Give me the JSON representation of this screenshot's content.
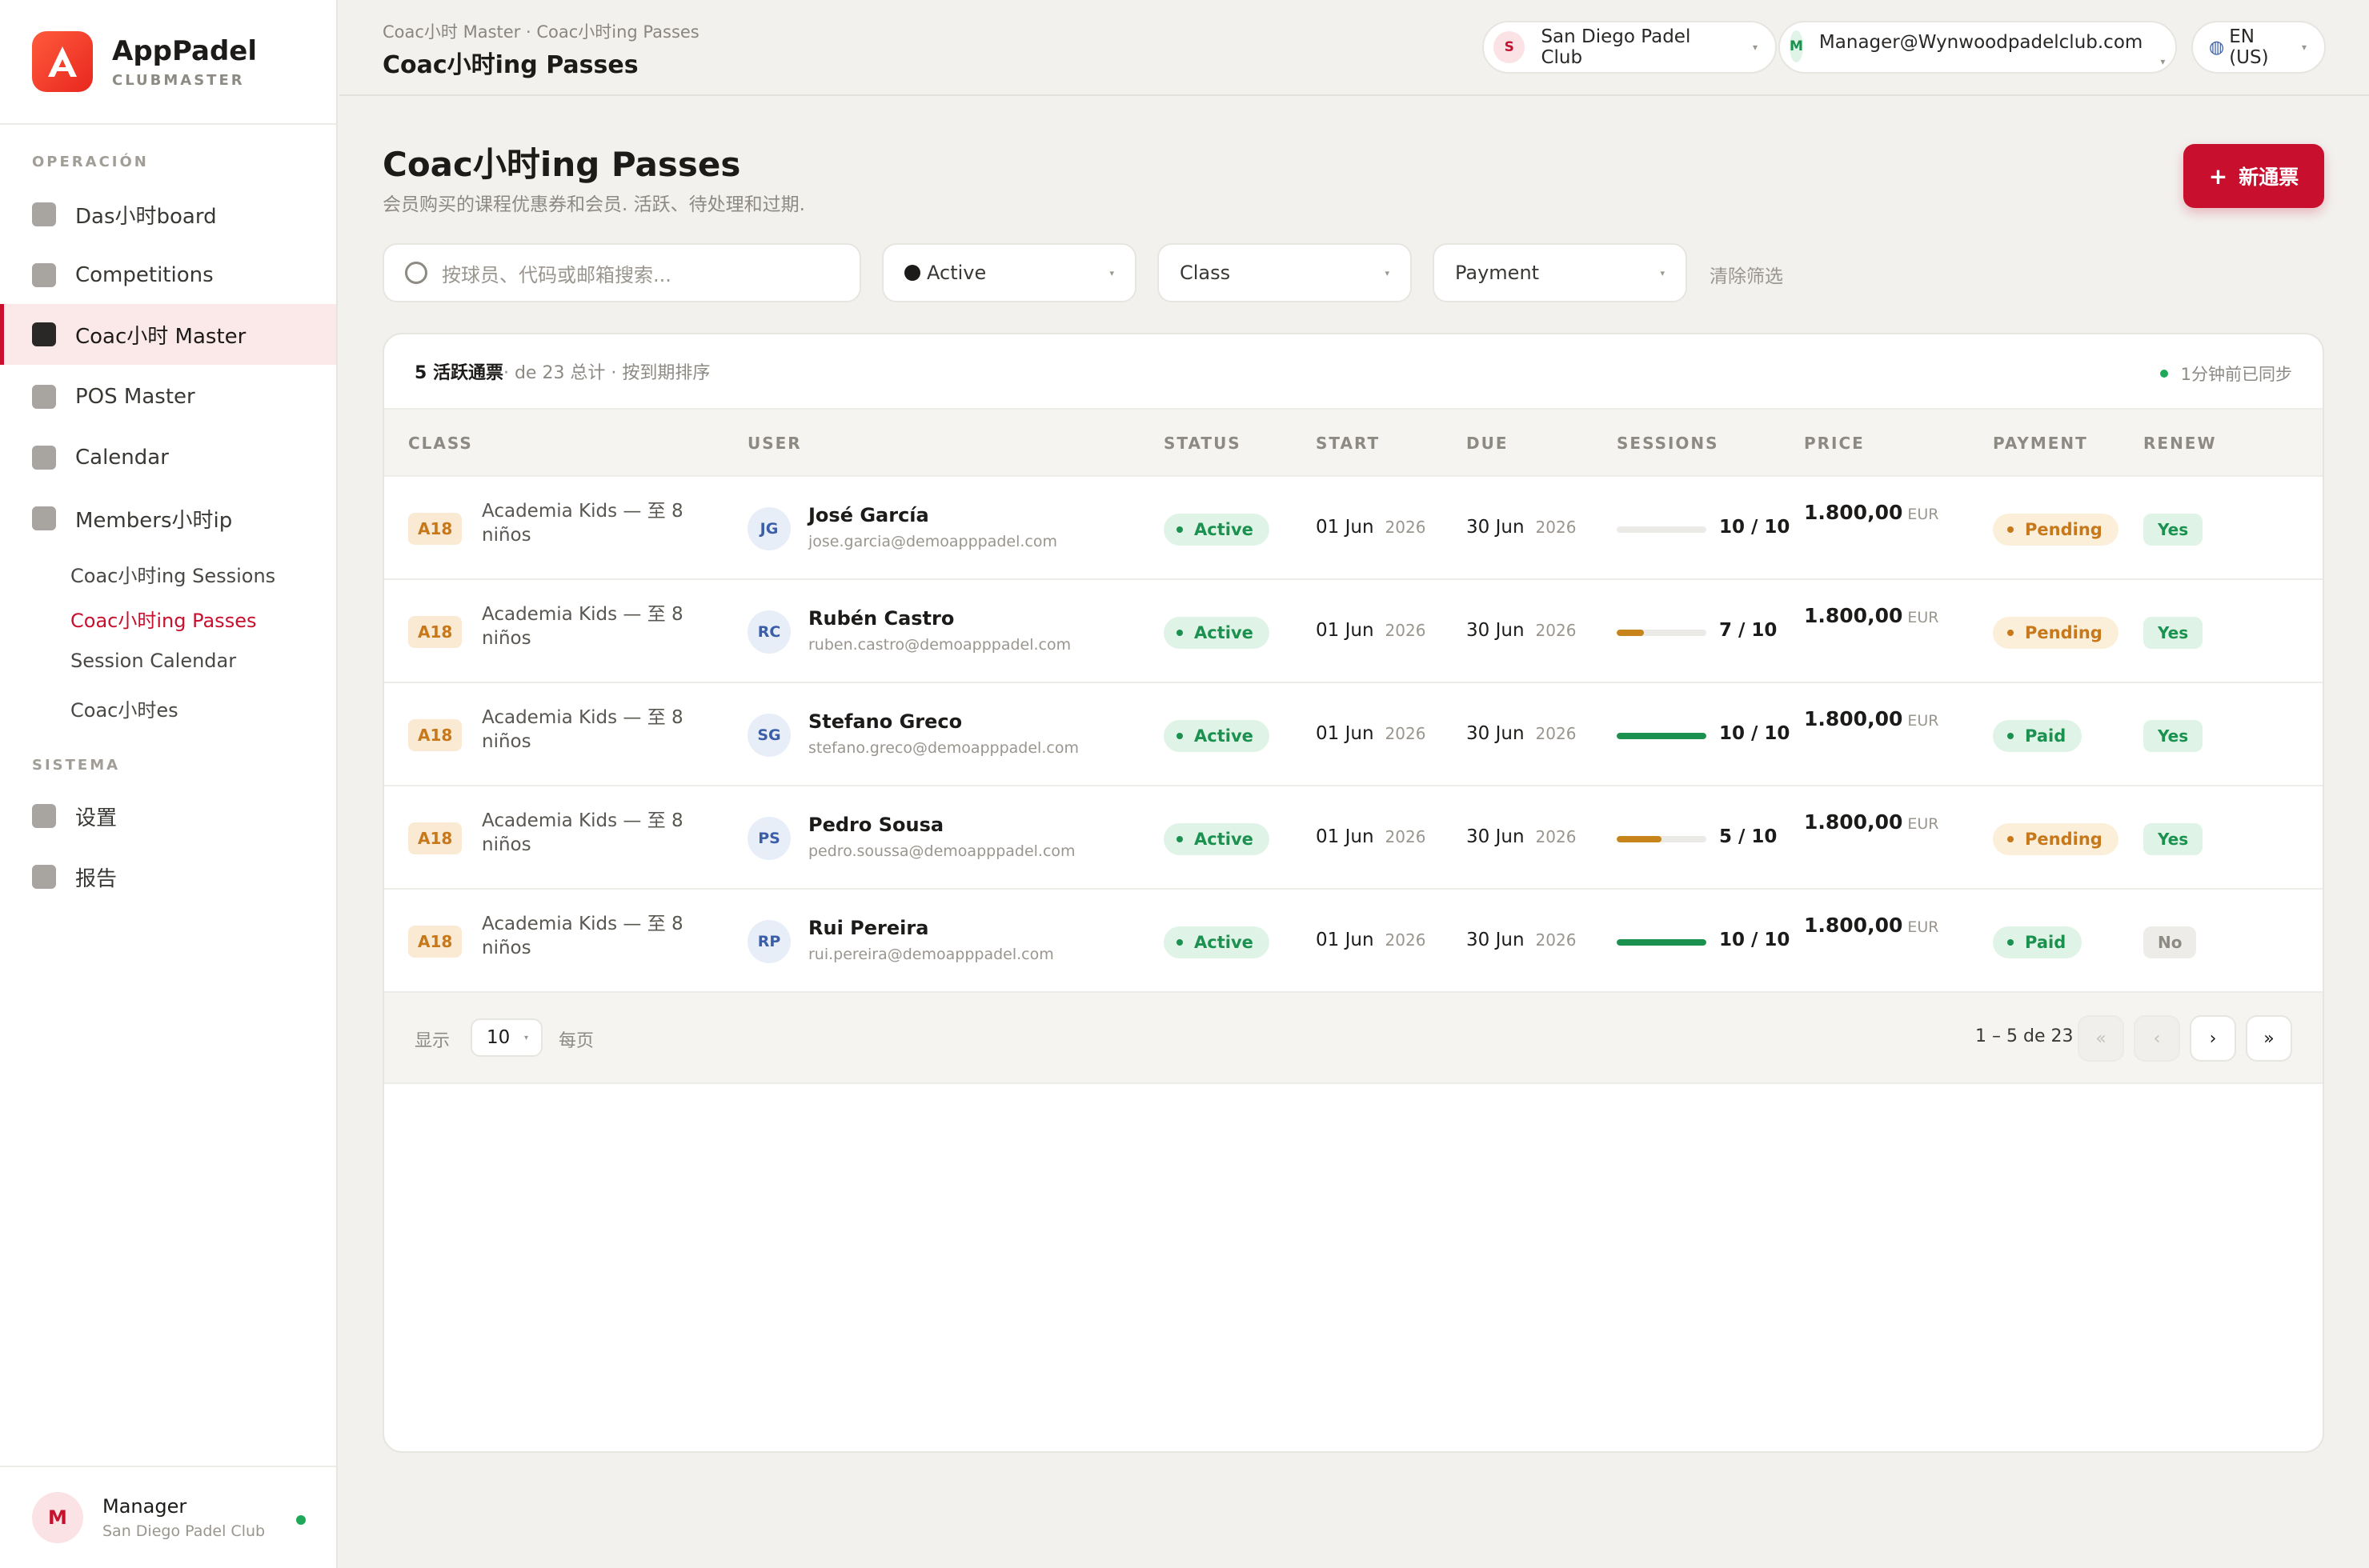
{
  "app": {
    "name": "AppPadel",
    "subtitle": "CLUBMASTER"
  },
  "sidebar": {
    "section_ops": "OPERACIÓN",
    "section_sys": "SISTEMA",
    "items": [
      {
        "label": "Das小时board"
      },
      {
        "label": "Competitions"
      },
      {
        "label": "Coac小时 Master"
      },
      {
        "label": "POS Master"
      },
      {
        "label": "Calendar"
      },
      {
        "label": "Members小时ip"
      }
    ],
    "sub_items": [
      {
        "label": "Coac小时ing Sessions"
      },
      {
        "label": "Coac小时ing Passes"
      },
      {
        "label": "Session Calendar"
      },
      {
        "label": "Coac小时es"
      }
    ],
    "system_items": [
      {
        "label": "设置"
      },
      {
        "label": "报告"
      }
    ],
    "user": {
      "initial": "M",
      "name": "Manager",
      "club": "San Diego Padel Club"
    }
  },
  "topbar": {
    "breadcrumb": "Coac小时 Master · Coac小时ing Passes",
    "title": "Coac小时ing Passes",
    "club": {
      "initial": "S",
      "label": "San Diego Padel Club"
    },
    "account": {
      "initial": "M",
      "label": "Manager@Wynwoodpadelclub.com"
    },
    "language": "EN (US)"
  },
  "page": {
    "title": "Coac小时ing Passes",
    "subtitle": "会员购买的课程优惠券和会员. 活跃、待处理和过期.",
    "new_button": "新通票"
  },
  "filters": {
    "search_placeholder": "按球员、代码或邮箱搜索...",
    "status": "Active",
    "class": "Class",
    "payment": "Payment",
    "clear": "清除筛选"
  },
  "table": {
    "summary_count": "5 活跃通票",
    "summary_rest": " · de 23 总计 · 按到期排序",
    "sync": "1分钟前已同步",
    "columns": [
      "CLASS",
      "USER",
      "STATUS",
      "START",
      "DUE",
      "SESSIONS",
      "PRICE",
      "PAYMENT",
      "RENEW"
    ],
    "rows": [
      {
        "class_code": "A18",
        "class_name": "Academia Kids — 至 8 niños",
        "initials": "JG",
        "name": "José García",
        "email": "jose.garcia@demoapppadel.com",
        "status": "Active",
        "start": "01 Jun",
        "start_year": "2026",
        "due": "30 Jun",
        "due_year": "2026",
        "sessions": "10 / 10",
        "progress": 0.0,
        "price": "1.800,00",
        "currency": "EUR",
        "payment": "Pending",
        "renew": "Yes"
      },
      {
        "class_code": "A18",
        "class_name": "Academia Kids — 至 8 niños",
        "initials": "RC",
        "name": "Rubén Castro",
        "email": "ruben.castro@demoapppadel.com",
        "status": "Active",
        "start": "01 Jun",
        "start_year": "2026",
        "due": "30 Jun",
        "due_year": "2026",
        "sessions": "7 / 10",
        "progress": 0.3,
        "price": "1.800,00",
        "currency": "EUR",
        "payment": "Pending",
        "renew": "Yes"
      },
      {
        "class_code": "A18",
        "class_name": "Academia Kids — 至 8 niños",
        "initials": "SG",
        "name": "Stefano Greco",
        "email": "stefano.greco@demoapppadel.com",
        "status": "Active",
        "start": "01 Jun",
        "start_year": "2026",
        "due": "30 Jun",
        "due_year": "2026",
        "sessions": "10 / 10",
        "progress": 1.0,
        "price": "1.800,00",
        "currency": "EUR",
        "payment": "Paid",
        "renew": "Yes"
      },
      {
        "class_code": "A18",
        "class_name": "Academia Kids — 至 8 niños",
        "initials": "PS",
        "name": "Pedro Sousa",
        "email": "pedro.soussa@demoapppadel.com",
        "status": "Active",
        "start": "01 Jun",
        "start_year": "2026",
        "due": "30 Jun",
        "due_year": "2026",
        "sessions": "5 / 10",
        "progress": 0.5,
        "price": "1.800,00",
        "currency": "EUR",
        "payment": "Pending",
        "renew": "Yes"
      },
      {
        "class_code": "A18",
        "class_name": "Academia Kids — 至 8 niños",
        "initials": "RP",
        "name": "Rui Pereira",
        "email": "rui.pereira@demoapppadel.com",
        "status": "Active",
        "start": "01 Jun",
        "start_year": "2026",
        "due": "30 Jun",
        "due_year": "2026",
        "sessions": "10 / 10",
        "progress": 1.0,
        "price": "1.800,00",
        "currency": "EUR",
        "payment": "Paid",
        "renew": "No"
      }
    ]
  },
  "pagination": {
    "show": "显示",
    "per_page_value": "10",
    "per_page": "每页",
    "range": "1 – 5 de 23",
    "first": "«",
    "prev": "‹",
    "next": "›",
    "last": "»"
  },
  "colors": {
    "accent": "#c8102e",
    "active_green": "#1b9150",
    "pending_amber": "#c7781a",
    "progress_green": "#1b9150",
    "progress_amber": "#c7841a"
  }
}
